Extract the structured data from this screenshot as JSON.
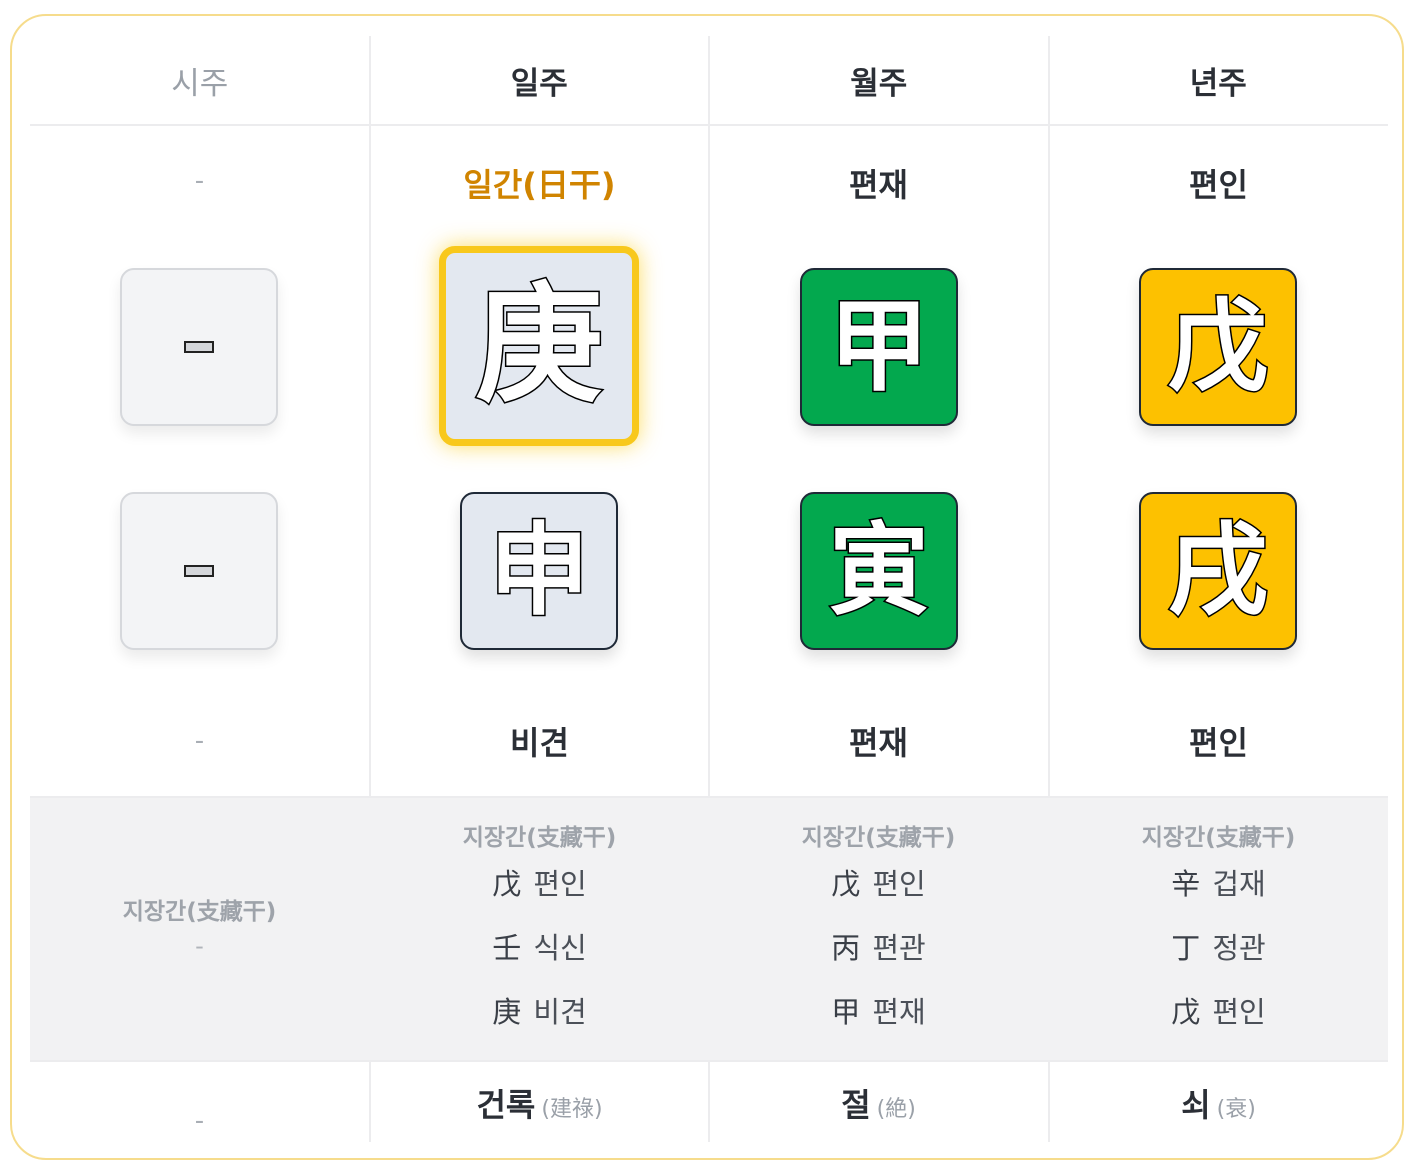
{
  "columns": [
    {
      "header": "시주",
      "muted": true,
      "stem_ten_god": "-",
      "branch_ten_god": "-",
      "stem": "",
      "branch": "",
      "stem_element": "empty",
      "branch_element": "empty",
      "hidden_title": "지장간(支藏干)",
      "hidden_items": [],
      "hidden_dash": "-",
      "stage_main": "-",
      "stage_sub": ""
    },
    {
      "header": "일주",
      "muted": false,
      "stem_ten_god": "일간(日干)",
      "branch_ten_god": "비견",
      "stem": "庚",
      "branch": "申",
      "stem_element": "metal",
      "branch_element": "metal",
      "hidden_title": "지장간(支藏干)",
      "hidden_items": [
        {
          "han": "戊",
          "name": "편인"
        },
        {
          "han": "壬",
          "name": "식신"
        },
        {
          "han": "庚",
          "name": "비견"
        }
      ],
      "stage_main": "건록",
      "stage_sub": "(建祿)"
    },
    {
      "header": "월주",
      "muted": false,
      "stem_ten_god": "편재",
      "branch_ten_god": "편재",
      "stem": "甲",
      "branch": "寅",
      "stem_element": "wood",
      "branch_element": "wood",
      "hidden_title": "지장간(支藏干)",
      "hidden_items": [
        {
          "han": "戊",
          "name": "편인"
        },
        {
          "han": "丙",
          "name": "편관"
        },
        {
          "han": "甲",
          "name": "편재"
        }
      ],
      "stage_main": "절",
      "stage_sub": "(絶)"
    },
    {
      "header": "년주",
      "muted": false,
      "stem_ten_god": "편인",
      "branch_ten_god": "편인",
      "stem": "戊",
      "branch": "戌",
      "stem_element": "earth",
      "branch_element": "earth",
      "hidden_title": "지장간(支藏干)",
      "hidden_items": [
        {
          "han": "辛",
          "name": "겁재"
        },
        {
          "han": "丁",
          "name": "정관"
        },
        {
          "han": "戊",
          "name": "편인"
        }
      ],
      "stage_main": "쇠",
      "stage_sub": "(衰)"
    }
  ],
  "colors": {
    "wood": "#03a84e",
    "earth": "#fdc100",
    "metal": "#e3e8f0",
    "day_master_border": "#f8c81c",
    "day_master_label": "#d08400",
    "card_border": "#f6dc8c"
  }
}
